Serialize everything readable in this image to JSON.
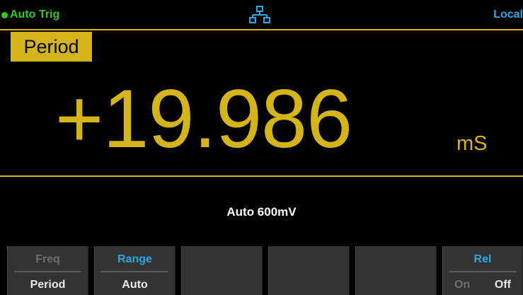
{
  "status": {
    "trigger": "Auto Trig",
    "network_icon": "lan-network-icon",
    "remote_state": "Local"
  },
  "function": {
    "label": "Period"
  },
  "measurement": {
    "value": "+19.986",
    "unit": "mS"
  },
  "range_info": "Auto  600mV",
  "softkeys": [
    {
      "top": "Freq",
      "bottom": "Period"
    },
    {
      "top": "Range",
      "bottom": "Auto"
    },
    {
      "top": "",
      "bottom": ""
    },
    {
      "top": "",
      "bottom": ""
    },
    {
      "top": "",
      "bottom": ""
    },
    {
      "top": "Rel",
      "on": "On",
      "off": "Off"
    }
  ],
  "colors": {
    "accent": "#d4b418",
    "trigger": "#2ecc1f",
    "highlight": "#2ba7e6",
    "softkey_bg": "#333333",
    "background": "#000000"
  }
}
